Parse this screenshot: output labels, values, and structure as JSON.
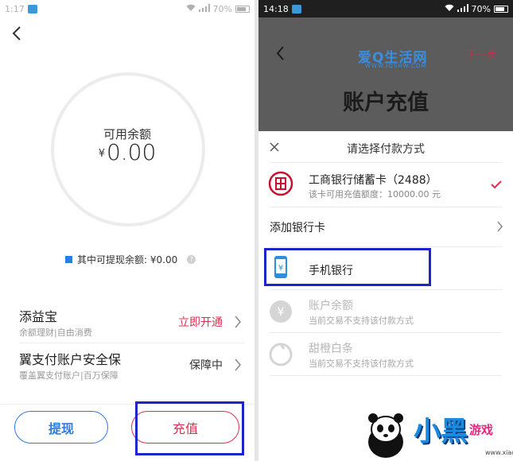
{
  "left": {
    "status": {
      "time": "1:17",
      "battery": "70%"
    },
    "balance": {
      "label": "可用余额",
      "currency": "¥",
      "amount": "0.00"
    },
    "withdrawable": {
      "label": "其中可提现余额: ¥0.00",
      "help": "?"
    },
    "items": [
      {
        "title": "添益宝",
        "subtitle": "余额理财|自由消费",
        "action": "立即开通"
      },
      {
        "title": "翼支付账户安全保",
        "subtitle": "覆盖翼支付账户|百万保障",
        "action": "保障中"
      }
    ],
    "buttons": {
      "withdraw": "提现",
      "recharge": "充值"
    },
    "colors": {
      "accent_blue": "#2f7be4",
      "accent_red": "#d9304f",
      "highlight": "#1c25c9"
    }
  },
  "right": {
    "status": {
      "time": "14:18",
      "battery": "70%"
    },
    "header": {
      "logo": "爱Q生活网",
      "logo_url": "WWW.IQSHW.COM",
      "next": "下一步",
      "title": "账户充值"
    },
    "sheet": {
      "title": "请选择付款方式",
      "options": [
        {
          "name": "工商银行储蓄卡（2488）",
          "subtitle": "该卡可用充值额度：10000.00 元",
          "selected": true
        },
        {
          "name": "添加银行卡"
        },
        {
          "name": "手机银行"
        },
        {
          "name": "账户余额",
          "subtitle": "当前交易不支持该付款方式",
          "disabled": true
        },
        {
          "name": "甜橙白条",
          "subtitle": "当前交易不支持该付款方式",
          "disabled": true
        }
      ]
    },
    "watermark": {
      "text": "小黑",
      "text2": "游戏",
      "url": "www.xiaohei.com"
    }
  }
}
